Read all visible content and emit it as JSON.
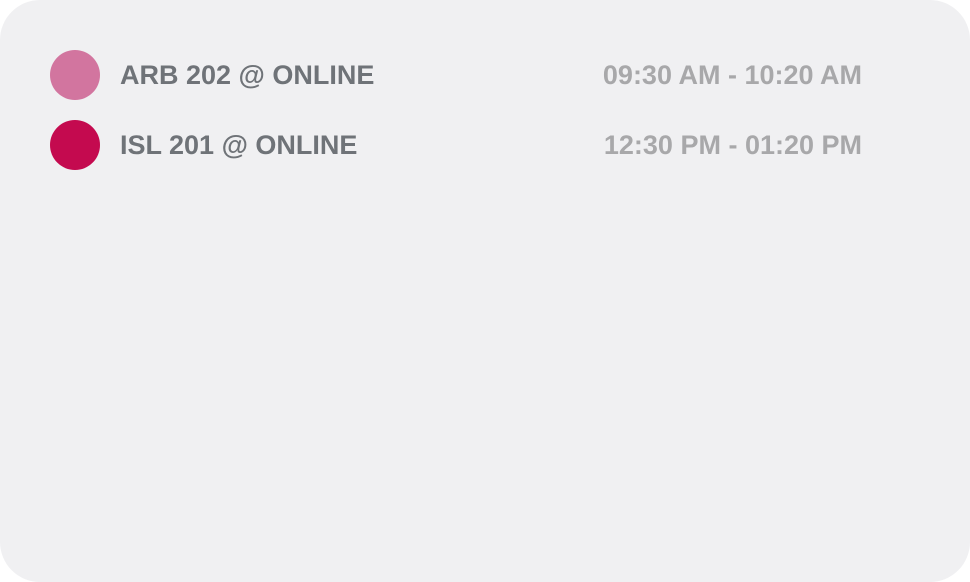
{
  "events": [
    {
      "title": "ARB 202 @ ONLINE",
      "time": "09:30 AM - 10:20 AM",
      "color": "#d2759f"
    },
    {
      "title": "ISL 201 @ ONLINE",
      "time": "12:30 PM - 01:20 PM",
      "color": "#c40a4f"
    }
  ]
}
